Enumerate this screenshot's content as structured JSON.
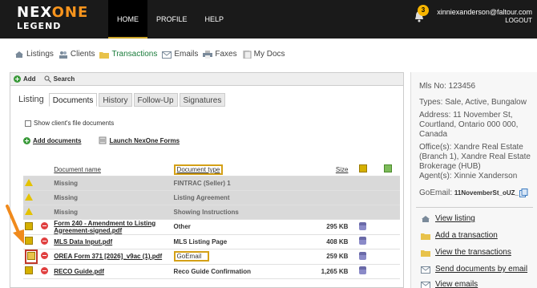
{
  "brand": {
    "line1_a": "NEX",
    "line1_b": "ONE",
    "line2": "LEGEND"
  },
  "nav": [
    {
      "label": "HOME"
    },
    {
      "label": "PROFILE"
    },
    {
      "label": "HELP"
    }
  ],
  "user": {
    "email": "xinniexanderson@faltour.com",
    "logout": "LOGOUT",
    "notifications": "3"
  },
  "subnav": [
    {
      "label": "Listings"
    },
    {
      "label": "Clients"
    },
    {
      "label": "Transactions"
    },
    {
      "label": "Emails"
    },
    {
      "label": "Faxes"
    },
    {
      "label": "My Docs"
    }
  ],
  "toolbar": {
    "add": "Add",
    "search": "Search"
  },
  "tabs": [
    {
      "label": "Listing"
    },
    {
      "label": "Documents"
    },
    {
      "label": "History"
    },
    {
      "label": "Follow-Up"
    },
    {
      "label": "Signatures"
    }
  ],
  "show_client_docs": "Show client's file documents",
  "actions": {
    "add_documents": "Add documents",
    "launch_forms": "Launch NexOne Forms"
  },
  "table": {
    "headers": {
      "name": "Document name",
      "type": "Document type",
      "size": "Size"
    },
    "rows": [
      {
        "name": "Missing",
        "type": "FINTRAC (Seller) 1",
        "size": "",
        "status": "missing"
      },
      {
        "name": "Missing",
        "type": "Listing Agreement",
        "size": "",
        "status": "missing"
      },
      {
        "name": "Missing",
        "type": "Showing Instructions",
        "size": "",
        "status": "missing"
      },
      {
        "name": "Form 240 - Amendment to Listing Agreement-signed.pdf",
        "type": "Other",
        "size": "295 KB",
        "status": "doc"
      },
      {
        "name": "MLS Data Input.pdf",
        "type": "MLS Listing Page",
        "size": "408 KB",
        "status": "doc"
      },
      {
        "name": "OREA Form 371 [2026]_v9ac (1).pdf",
        "type": "GoEmail",
        "size": "259 KB",
        "status": "doc"
      },
      {
        "name": "RECO Guide.pdf",
        "type": "Reco Guide Confirmation",
        "size": "1,265 KB",
        "status": "doc"
      }
    ]
  },
  "details": {
    "mls": "Mls No:  123456",
    "types": "Types: Sale, Active, Bungalow",
    "address": "Address: 11 November St, Courtland, Ontario 000 000, Canada",
    "offices": "Office(s): Xandre Real Estate (Branch 1), Xandre Real Estate Brokerage (HUB)",
    "agents": "Agent(s): Xinnie Xanderson",
    "goemail_label": "GoEmail: ",
    "goemail_value": "11NovemberSt_oUZ_"
  },
  "side_actions": [
    {
      "label": "View listing"
    },
    {
      "label": "Add a transaction"
    },
    {
      "label": "View the transactions"
    },
    {
      "label": "Send documents by email"
    },
    {
      "label": "View emails"
    }
  ],
  "colors": {
    "accent": "#f7941d",
    "highlight": "#d4a017",
    "arrow": "#f08a1c",
    "active_nav": "#1a7c3b"
  }
}
